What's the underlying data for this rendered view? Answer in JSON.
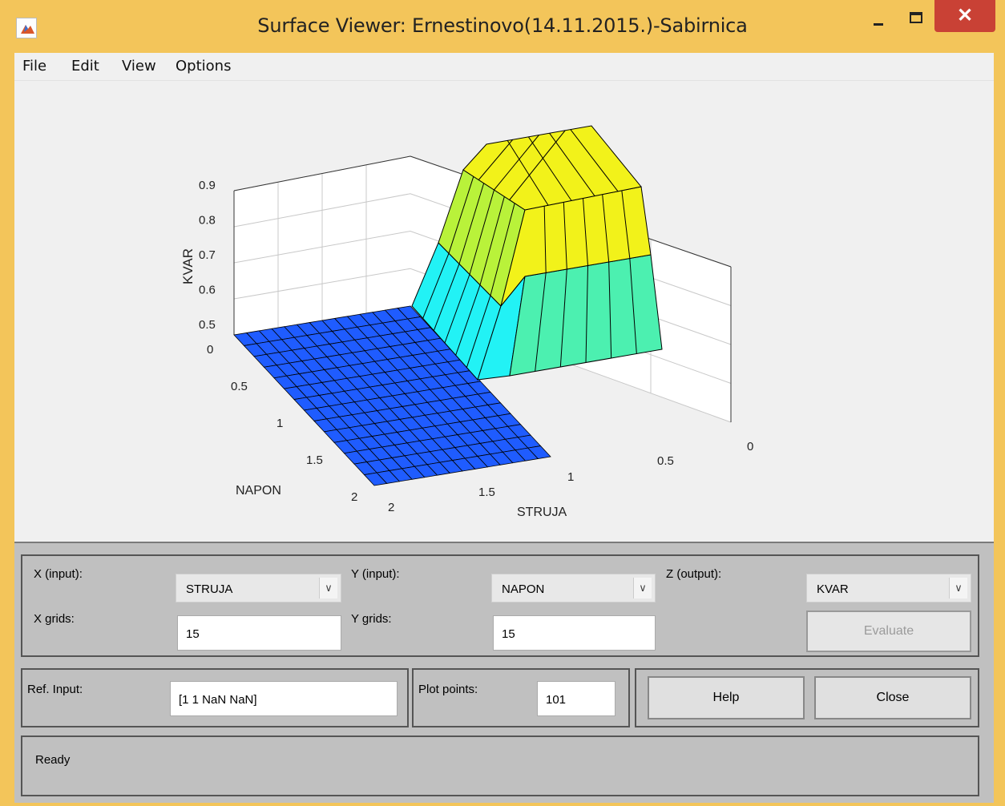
{
  "window": {
    "title": "Surface Viewer: Ernestinovo(14.11.2015.)-Sabirnica",
    "close_glyph": "✕"
  },
  "menu": [
    "File",
    "Edit",
    "View",
    "Options"
  ],
  "plot": {
    "z_label": "KVAR",
    "x_label": "STRUJA",
    "y_label": "NAPON",
    "z_ticks": [
      "0.9",
      "0.8",
      "0.7",
      "0.6",
      "0.5"
    ],
    "napon_ticks": [
      "0",
      "0.5",
      "1",
      "1.5",
      "2"
    ],
    "struja_ticks": [
      "2",
      "1.5",
      "1",
      "0.5",
      "0"
    ],
    "colors": {
      "floor": "#1f5cff",
      "cyan": "#22f2f5",
      "green": "#4cf0b0",
      "yellow": "#f2f21a",
      "yellowgreen": "#b9f23a"
    }
  },
  "controls": {
    "x_input_label": "X (input):",
    "x_input_value": "STRUJA",
    "y_input_label": "Y (input):",
    "y_input_value": "NAPON",
    "z_output_label": "Z (output):",
    "z_output_value": "KVAR",
    "x_grids_label": "X grids:",
    "x_grids_value": "15",
    "y_grids_label": "Y grids:",
    "y_grids_value": "15",
    "evaluate_label": "Evaluate",
    "ref_input_label": "Ref. Input:",
    "ref_input_value": "[1 1 NaN NaN]",
    "plot_points_label": "Plot points:",
    "plot_points_value": "101",
    "help_label": "Help",
    "close_label": "Close",
    "status": "Ready",
    "dropdown_arrow": "∨"
  }
}
